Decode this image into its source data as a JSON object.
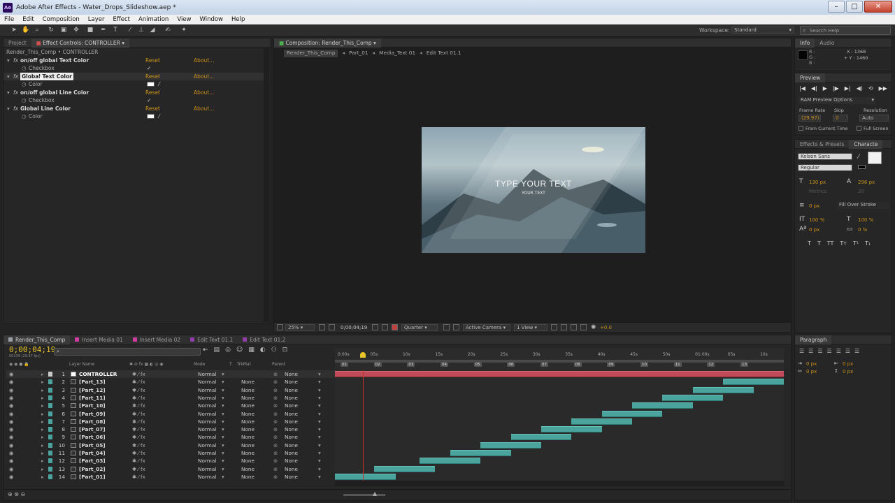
{
  "window": {
    "title": "Adobe After Effects - Water_Drops_Slideshow.aep *",
    "app_badge": "Ae"
  },
  "menu": [
    "File",
    "Edit",
    "Composition",
    "Layer",
    "Effect",
    "Animation",
    "View",
    "Window",
    "Help"
  ],
  "workspace": {
    "label": "Workspace:",
    "value": "Standard",
    "search_placeholder": "Search Help"
  },
  "left_panel": {
    "tabs": [
      "Project",
      "Effect Controls: CONTROLLER"
    ],
    "breadcrumb": "Render_This_Comp • CONTROLLER",
    "effects": [
      {
        "name": "on/off global Text Color",
        "prop": "Checkbox",
        "reset": "Reset",
        "about": "About...",
        "kind": "check"
      },
      {
        "name": "Global Text Color",
        "prop": "Color",
        "reset": "Reset",
        "about": "About...",
        "kind": "color"
      },
      {
        "name": "on/off global Line Color",
        "prop": "Checkbox",
        "reset": "Reset",
        "about": "About...",
        "kind": "check"
      },
      {
        "name": "Global Line Color",
        "prop": "Color",
        "reset": "Reset",
        "about": "About...",
        "kind": "color"
      }
    ]
  },
  "comp_panel": {
    "tab": "Composition: Render_This_Comp",
    "breadcrumbs": [
      "Render_This_Comp",
      "Part_01",
      "Media_Text 01",
      "Edit Text 01.1"
    ],
    "preview_title": "TYPE YOUR TEXT",
    "preview_sub": "YOUR TEXT",
    "zoom": "25%",
    "timecode": "0;00;04;19",
    "resolution": "Quarter",
    "camera": "Active Camera",
    "views": "1 View",
    "exposure": "+0.0"
  },
  "info_panel": {
    "tabs": [
      "Info",
      "Audio"
    ],
    "r": "R :",
    "g": "G :",
    "b": "B :",
    "x": "X : 1368",
    "y": "+ Y : 1460"
  },
  "preview_panel": {
    "title": "Preview",
    "ram_option": "RAM Preview Options",
    "frame_rate_label": "Frame Rate",
    "skip_label": "Skip",
    "resolution_label": "Resolution",
    "frame_rate": "(29.97)",
    "skip": "0",
    "resolution": "Auto",
    "from_current": "From Current Time",
    "full_screen": "Full Screen"
  },
  "char_panel": {
    "tabs": [
      "Effects & Presets",
      "Characte"
    ],
    "font": "Kelson Sans",
    "style": "Regular",
    "size": "130 px",
    "leading": "296 px",
    "kerning": "Metrics",
    "tracking": "20",
    "stroke": "0 px",
    "stroke_mode": "Fill Over Stroke",
    "vscale": "100 %",
    "hscale": "100 %",
    "baseline": "0 px",
    "tsume": "0 %",
    "styles": [
      "T",
      "T",
      "TT",
      "Tт",
      "T¹",
      "T₁"
    ]
  },
  "paragraph_panel": {
    "title": "Paragraph",
    "indents": [
      "0 px",
      "0 px",
      "0 px",
      "0 px",
      "0 px"
    ]
  },
  "timeline": {
    "tabs": [
      {
        "name": "Render_This_Comp",
        "color": "#9aa0a6"
      },
      {
        "name": "Insert Media 01",
        "color": "#d23ca0"
      },
      {
        "name": "Insert Media 02",
        "color": "#d23ca0"
      },
      {
        "name": "Edit Text 01.1",
        "color": "#8f3ea8"
      },
      {
        "name": "Edit Text 01.2",
        "color": "#8f3ea8"
      }
    ],
    "current_time": "0;00;04;19",
    "frame_info": "00139 (29.97 fps)",
    "headers": {
      "layer_name": "Layer Name",
      "mode": "Mode",
      "t": "T",
      "trkmat": "TrkMat",
      "parent": "Parent"
    },
    "ruler": [
      "0:00s",
      "05s",
      "10s",
      "15s",
      "20s",
      "25s",
      "30s",
      "35s",
      "40s",
      "45s",
      "50s",
      "01:00s",
      "05s",
      "10s"
    ],
    "markers": [
      "01",
      "02",
      "03",
      "04",
      "05",
      "06",
      "07",
      "08",
      "09",
      "10",
      "11",
      "12",
      "13"
    ],
    "playhead_sec": 4.6,
    "duration_sec": 74,
    "layers": [
      {
        "num": "1",
        "name": "CONTROLLER",
        "mode": "Normal",
        "trkmat": "",
        "parent": "None",
        "color": "#c9c9c9",
        "in": 0,
        "out": 74,
        "bar": "red"
      },
      {
        "num": "2",
        "name": "[Part_13]",
        "mode": "Normal",
        "trkmat": "None",
        "parent": "None",
        "color": "#4aa39c",
        "in": 64,
        "out": 74,
        "bar": "teal"
      },
      {
        "num": "3",
        "name": "[Part_12]",
        "mode": "Normal",
        "trkmat": "None",
        "parent": "None",
        "color": "#4aa39c",
        "in": 59,
        "out": 69,
        "bar": "teal"
      },
      {
        "num": "4",
        "name": "[Part_11]",
        "mode": "Normal",
        "trkmat": "None",
        "parent": "None",
        "color": "#4aa39c",
        "in": 54,
        "out": 64,
        "bar": "teal"
      },
      {
        "num": "5",
        "name": "[Part_10]",
        "mode": "Normal",
        "trkmat": "None",
        "parent": "None",
        "color": "#4aa39c",
        "in": 49,
        "out": 59,
        "bar": "teal"
      },
      {
        "num": "6",
        "name": "[Part_09]",
        "mode": "Normal",
        "trkmat": "None",
        "parent": "None",
        "color": "#4aa39c",
        "in": 44,
        "out": 54,
        "bar": "teal"
      },
      {
        "num": "7",
        "name": "[Part_08]",
        "mode": "Normal",
        "trkmat": "None",
        "parent": "None",
        "color": "#4aa39c",
        "in": 39,
        "out": 49,
        "bar": "teal"
      },
      {
        "num": "8",
        "name": "[Part_07]",
        "mode": "Normal",
        "trkmat": "None",
        "parent": "None",
        "color": "#4aa39c",
        "in": 34,
        "out": 44,
        "bar": "teal"
      },
      {
        "num": "9",
        "name": "[Part_06]",
        "mode": "Normal",
        "trkmat": "None",
        "parent": "None",
        "color": "#4aa39c",
        "in": 29,
        "out": 39,
        "bar": "teal"
      },
      {
        "num": "10",
        "name": "[Part_05]",
        "mode": "Normal",
        "trkmat": "None",
        "parent": "None",
        "color": "#4aa39c",
        "in": 24,
        "out": 34,
        "bar": "teal"
      },
      {
        "num": "11",
        "name": "[Part_04]",
        "mode": "Normal",
        "trkmat": "None",
        "parent": "None",
        "color": "#4aa39c",
        "in": 19,
        "out": 29,
        "bar": "teal"
      },
      {
        "num": "12",
        "name": "[Part_03]",
        "mode": "Normal",
        "trkmat": "None",
        "parent": "None",
        "color": "#4aa39c",
        "in": 14,
        "out": 24,
        "bar": "teal"
      },
      {
        "num": "13",
        "name": "[Part_02]",
        "mode": "Normal",
        "trkmat": "None",
        "parent": "None",
        "color": "#4aa39c",
        "in": 6.5,
        "out": 16.5,
        "bar": "teal"
      },
      {
        "num": "14",
        "name": "[Part_01]",
        "mode": "Normal",
        "trkmat": "None",
        "parent": "None",
        "color": "#4aa39c",
        "in": 0,
        "out": 10,
        "bar": "teal"
      }
    ]
  },
  "colors": {
    "accent_orange": "#c8901a",
    "playhead": "#e8c52b",
    "red_bar": "#c04a58",
    "teal_bar": "#4aa39c"
  }
}
